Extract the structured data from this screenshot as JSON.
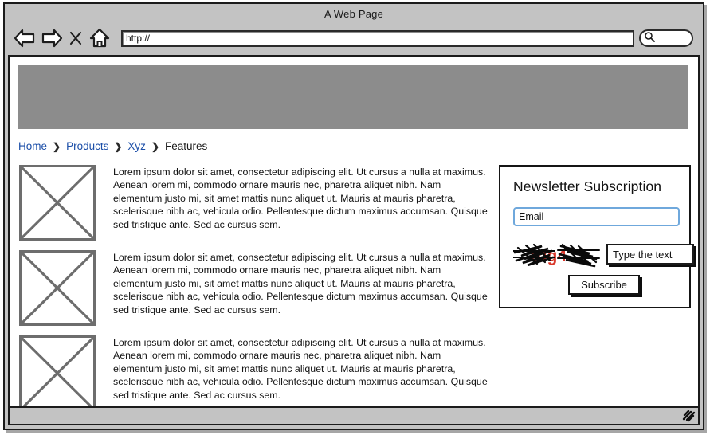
{
  "window": {
    "title": "A Web Page"
  },
  "toolbar": {
    "back_icon": "back-arrow-icon",
    "forward_icon": "forward-arrow-icon",
    "stop_icon": "stop-x-icon",
    "home_icon": "home-icon",
    "url_value": "http://",
    "url_placeholder": "http://",
    "search_icon": "magnifier-icon",
    "search_value": "",
    "search_placeholder": ""
  },
  "page": {
    "banner_color": "#8c8c8c",
    "breadcrumb": {
      "separator": "❯",
      "items": [
        {
          "label": "Home",
          "is_link": true
        },
        {
          "label": "Products",
          "is_link": true
        },
        {
          "label": "Xyz",
          "is_link": true
        },
        {
          "label": "Features",
          "is_link": false
        }
      ]
    },
    "articles": [
      {
        "image_alt": "image-placeholder",
        "text": "Lorem ipsum dolor sit amet, consectetur adipiscing elit. Ut cursus a nulla at maximus. Aenean lorem mi, commodo ornare mauris nec, pharetra aliquet nibh. Nam elementum justo mi, sit amet mattis nunc aliquet ut. Mauris at mauris pharetra, scelerisque nibh ac, vehicula odio. Pellentesque dictum maximus accumsan. Quisque sed tristique ante. Sed ac cursus sem."
      },
      {
        "image_alt": "image-placeholder",
        "text": "Lorem ipsum dolor sit amet, consectetur adipiscing elit. Ut cursus a nulla at maximus. Aenean lorem mi, commodo ornare mauris nec, pharetra aliquet nibh. Nam elementum justo mi, sit amet mattis nunc aliquet ut. Mauris at mauris pharetra, scelerisque nibh ac, vehicula odio. Pellentesque dictum maximus accumsan. Quisque sed tristique ante. Sed ac cursus sem."
      },
      {
        "image_alt": "image-placeholder",
        "text": "Lorem ipsum dolor sit amet, consectetur adipiscing elit. Ut cursus a nulla at maximus. Aenean lorem mi, commodo ornare mauris nec, pharetra aliquet nibh. Nam elementum justo mi, sit amet mattis nunc aliquet ut. Mauris at mauris pharetra, scelerisque nibh ac, vehicula odio. Pellentesque dictum maximus accumsan. Quisque sed tristique ante. Sed ac cursus sem."
      }
    ],
    "newsletter": {
      "title": "Newsletter Subscription",
      "email_value": "Email",
      "email_placeholder": "Email",
      "email_border_color": "#6fa8dc",
      "captcha_text": "1dg4",
      "captcha_text_color": "#d9382b",
      "captcha_input_value": "Type the text",
      "captcha_input_placeholder": "Type the text",
      "subscribe_label": "Subscribe"
    }
  },
  "status_bar": {
    "text": "",
    "resize_icon": "resize-grip-icon"
  }
}
